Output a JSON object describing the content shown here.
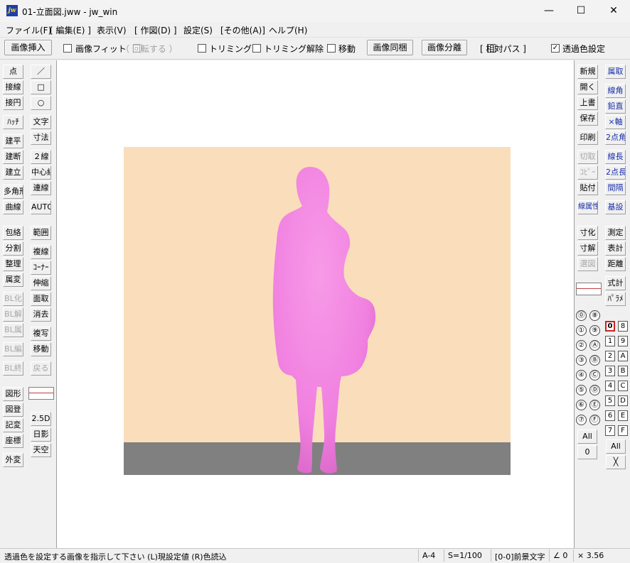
{
  "window": {
    "title": "01-立面図.jww - jw_win",
    "icon_text": "jw",
    "minimize": "—",
    "maximize": "☐",
    "close": "✕"
  },
  "menu": [
    "ファイル(F)",
    "[ 編集(E) ]",
    "表示(V)",
    "[ 作図(D) ]",
    "設定(S)",
    "[その他(A)]",
    "ヘルプ(H)"
  ],
  "toolbar": {
    "insert_image": "画像挿入",
    "image_fit": "画像フィット",
    "rotate": "（ 回転する ）",
    "trim": "トリミング",
    "trim_cancel": "トリミング解除",
    "move": "移動",
    "image_sync": "画像同梱",
    "image_split": "画像分離",
    "relative_path": "[ 相対パス ]",
    "transparent": "透過色設定"
  },
  "left_col1": [
    "点",
    "接線",
    "接円",
    "ﾊｯﾁ",
    "建平",
    "建断",
    "建立",
    "多角形",
    "曲線",
    "包絡",
    "分割",
    "整理",
    "属変",
    "BL化",
    "BL解",
    "BL属",
    "BL編",
    "BL終",
    "図形",
    "図登",
    "記変",
    "座標",
    "外変"
  ],
  "left_col2": [
    "／",
    "□",
    "○",
    "文字",
    "寸法",
    "２線",
    "中心線",
    "連線",
    "AUTO",
    "範囲",
    "複線",
    "ｺｰﾅｰ",
    "伸縮",
    "面取",
    "消去",
    "複写",
    "移動",
    "戻る",
    "2.5D",
    "日影",
    "天空"
  ],
  "right_col1": [
    "新規",
    "開く",
    "上書",
    "保存",
    "印刷",
    "切取",
    "ｺﾋﾟｰ",
    "貼付",
    "線属性",
    "寸化",
    "寸解",
    "選図"
  ],
  "right_col2": [
    "属取",
    "線角",
    "鉛直",
    "×軸",
    "2点角",
    "線長",
    "2点長",
    "間隔",
    "基設",
    "測定",
    "表計",
    "距離",
    "式計",
    "ﾊﾟﾗﾒ"
  ],
  "group_circles": [
    "⓪",
    "⑧",
    "①",
    "⑨",
    "②",
    "Ⓐ",
    "③",
    "Ⓑ",
    "④",
    "Ⓒ",
    "⑤",
    "Ⓓ",
    "⑥",
    "Ⓔ",
    "⑦",
    "Ⓕ"
  ],
  "group_all": "All",
  "group_zero": "0",
  "layers": [
    "0",
    "8",
    "1",
    "9",
    "2",
    "A",
    "3",
    "B",
    "4",
    "C",
    "5",
    "D",
    "6",
    "E",
    "7",
    "F"
  ],
  "layer_all": "All",
  "layer_x": "╳",
  "status": {
    "message": "透過色を設定する画像を指示して下さい (L)現設定値 (R)色読込",
    "paper": "A-4",
    "scale": "S=1/100",
    "layer": "[0-0]前景文字",
    "angle": "∠ 0",
    "factor": "× 3.56"
  },
  "colors": {
    "bg": "#FADEBB",
    "floor": "#808080",
    "figure": "#F080E0",
    "accent_blue": "#1a2fa8",
    "layer_active": "#d02020"
  }
}
